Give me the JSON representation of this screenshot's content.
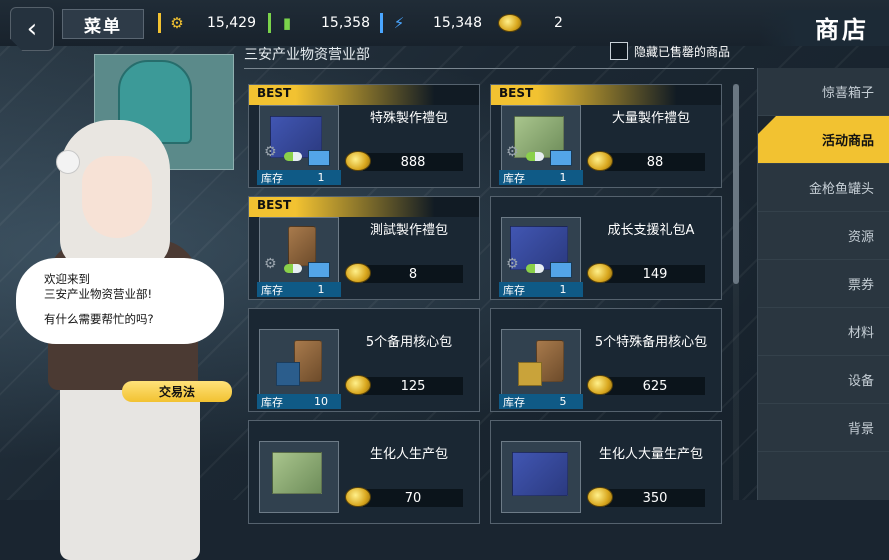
{
  "topbar": {
    "menu_label": "菜单",
    "resources": [
      {
        "icon": "gear-icon",
        "value": "15,429",
        "color": "#f2c231"
      },
      {
        "icon": "pill-icon",
        "value": "15,358",
        "color": "#7ad34b"
      },
      {
        "icon": "bolt-icon",
        "value": "15,348",
        "color": "#4aa6ff"
      },
      {
        "icon": "coin-icon",
        "value": "2",
        "color": "#f2c231"
      }
    ],
    "shop_title": "商店"
  },
  "left": {
    "speech_lines": [
      "欢迎来到",
      "三安产业物资营业部!",
      "有什么需要帮忙的吗?"
    ],
    "trade_button": "交易法"
  },
  "store": {
    "department": "三安产业物资营业部",
    "hide_sold_label": "隐藏已售罄的商品",
    "stock_label": "库存",
    "items": [
      {
        "title": "特殊製作禮包",
        "price": "888",
        "stock": "1",
        "best": "BEST",
        "box": "blue"
      },
      {
        "title": "大量製作禮包",
        "price": "88",
        "stock": "1",
        "best": "BEST",
        "box": "green"
      },
      {
        "title": "測試製作禮包",
        "price": "8",
        "stock": "1",
        "best": "BEST",
        "box": "bag"
      },
      {
        "title": "成长支援礼包A",
        "price": "149",
        "stock": "1",
        "best": "",
        "box": "blue"
      },
      {
        "title": "5个备用核心包",
        "price": "125",
        "stock": "10",
        "best": "",
        "box": "bag"
      },
      {
        "title": "5个特殊备用核心包",
        "price": "625",
        "stock": "5",
        "best": "",
        "box": "bag"
      },
      {
        "title": "生化人生产包",
        "price": "70",
        "stock": "",
        "best": "",
        "box": "green"
      },
      {
        "title": "生化人大量生产包",
        "price": "350",
        "stock": "",
        "best": "",
        "box": "blue"
      }
    ]
  },
  "nav": {
    "items": [
      {
        "label": "惊喜箱子",
        "active": false
      },
      {
        "label": "活动商品",
        "active": true
      },
      {
        "label": "金枪鱼罐头",
        "active": false
      },
      {
        "label": "资源",
        "active": false
      },
      {
        "label": "票券",
        "active": false
      },
      {
        "label": "材料",
        "active": false
      },
      {
        "label": "设备",
        "active": false
      },
      {
        "label": "背景",
        "active": false
      }
    ]
  }
}
